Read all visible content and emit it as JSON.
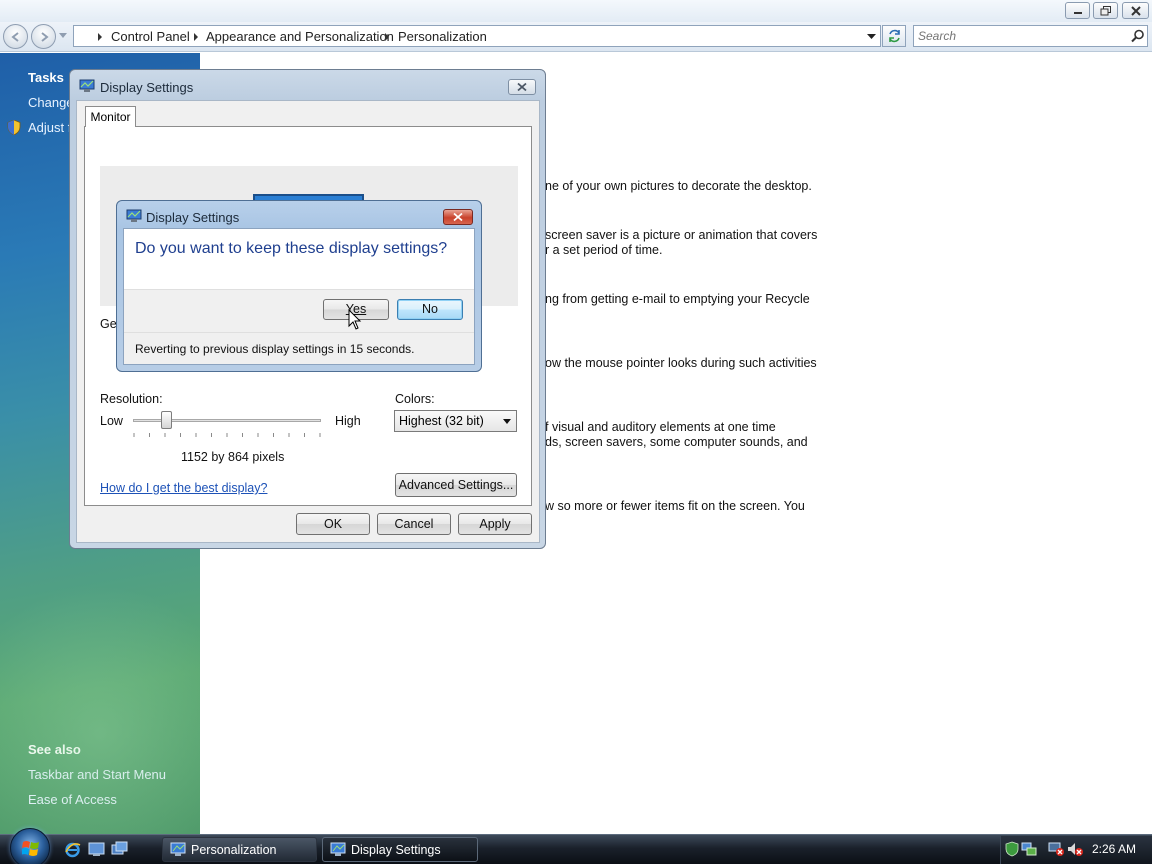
{
  "explorer": {
    "breadcrumbs": [
      "Control Panel",
      "Appearance and Personalization",
      "Personalization"
    ],
    "search_placeholder": "Search"
  },
  "taskpane": {
    "tasks_heading": "Tasks",
    "task_items": [
      "Change",
      "Adjust f"
    ],
    "see_also_heading": "See also",
    "see_also_items": [
      "Taskbar and Start Menu",
      "Ease of Access"
    ]
  },
  "content_lines": [
    "ne of your own pictures to decorate the desktop.",
    "screen saver is a picture or animation that covers",
    "r a set period of time.",
    "ng from getting e-mail to emptying your Recycle",
    "ow the mouse pointer looks during such activities",
    "f visual and auditory elements at one time",
    "ds, screen savers, some computer sounds, and",
    "w so more or fewer items fit on the screen. You"
  ],
  "display_settings": {
    "title": "Display Settings",
    "tab_label": "Monitor",
    "gen_label_fragment": "Ger",
    "resolution_label": "Resolution:",
    "low_label": "Low",
    "high_label": "High",
    "resolution_value": "1152 by 864 pixels",
    "resolution_slider_fraction": 0.18,
    "colors_label": "Colors:",
    "colors_selected": "Highest (32 bit)",
    "help_link": "How do I get the best display?",
    "advanced_button": "Advanced Settings...",
    "ok_button": "OK",
    "cancel_button": "Cancel",
    "apply_button": "Apply"
  },
  "confirm_dialog": {
    "title": "Display Settings",
    "question": "Do you want to keep these display settings?",
    "yes_button": "Yes",
    "no_button": "No",
    "revert_text": "Reverting to previous display settings in 15 seconds."
  },
  "taskbar": {
    "windows": [
      "Personalization",
      "Display Settings"
    ],
    "clock": "2:26 AM"
  }
}
